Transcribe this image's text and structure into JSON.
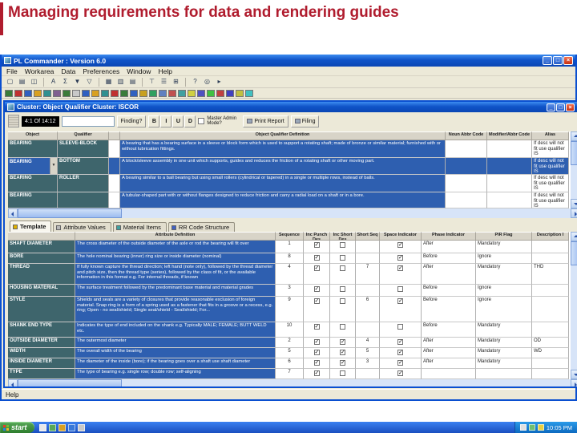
{
  "slide": {
    "title": "Managing requirements for data and rendering guides",
    "accent_color": "#B01C2E"
  },
  "app": {
    "title": "PL Commander : Version 6.0",
    "menus": [
      "File",
      "Workarea",
      "Data",
      "Preferences",
      "Window",
      "Help"
    ],
    "status": "Help"
  },
  "icons": {
    "dropdown": "▼"
  },
  "window_controls": [
    {
      "name": "minimize",
      "glyph": "_"
    },
    {
      "name": "maximize",
      "glyph": "□"
    },
    {
      "name": "close",
      "glyph": "×"
    }
  ],
  "toolbars": {
    "row1": [
      {
        "name": "new-icon",
        "glyph": "▢"
      },
      {
        "name": "open-icon",
        "glyph": "▤"
      },
      {
        "name": "save-icon",
        "glyph": "◫"
      },
      {
        "sep": true
      },
      {
        "name": "font-icon",
        "glyph": "A"
      },
      {
        "name": "sum-icon",
        "glyph": "Σ"
      },
      {
        "name": "sort-descending-icon",
        "glyph": "▼"
      },
      {
        "name": "filter-icon",
        "glyph": "▽"
      },
      {
        "sep": true
      },
      {
        "name": "grid-icon",
        "glyph": "▦"
      },
      {
        "name": "form-icon",
        "glyph": "▥"
      },
      {
        "name": "columns-icon",
        "glyph": "▤"
      },
      {
        "sep": true
      },
      {
        "name": "tree-icon",
        "glyph": "⊤"
      },
      {
        "name": "list-icon",
        "glyph": "☰"
      },
      {
        "name": "hierarchy-icon",
        "glyph": "⊞"
      },
      {
        "sep": true
      },
      {
        "name": "help-icon",
        "glyph": "?"
      },
      {
        "name": "search-icon",
        "glyph": "◎"
      },
      {
        "name": "go-icon",
        "glyph": "▸"
      }
    ],
    "row2_colors": [
      "#3a7c3a",
      "#c03030",
      "#3060c0",
      "#d8a020",
      "#309090",
      "#806090",
      "#3a7c3a",
      "#c8c8c8",
      "#3060c0",
      "#d8a020",
      "#309090",
      "#c03030",
      "#3a7c3a",
      "#3060c0",
      "#c8a020",
      "#30a060",
      "#6080c0",
      "#c05050",
      "#40a0a0",
      "#d0d040",
      "#5050c0",
      "#40c040",
      "#c04040",
      "#4040c0",
      "#c0c040",
      "#40c0c0"
    ]
  },
  "cluster": {
    "title": "Cluster: Object Qualifier Cluster: ISCOR",
    "toolbar": {
      "record_counter": "4:1 Of 14:12",
      "search_value": "",
      "find_button": "Finding?",
      "format_buttons": [
        "B",
        "I",
        "U",
        "D"
      ],
      "master_label": "Master Admin Mode?",
      "print_button": "Print Report",
      "filing_button": "Filing"
    },
    "grid": {
      "columns": [
        "Object",
        "Qualifier",
        "",
        "Object Qualifier Definition",
        "Noun Abbr Code",
        "Modifier/Abbr Code",
        "Alias"
      ],
      "rows": [
        {
          "object": "BEARING",
          "qualifier": "SLEEVE-BLOCK",
          "definition": "A bearing that has a bearing surface in a sleeve or block form which is used to support a rotating shaft; made of bronze or similar material; furnished with or without lubrication fittings.",
          "noun_abbr": "",
          "modifier_abbr": "",
          "alias": "If desc will not fit use qualifier IS",
          "selected": false,
          "combo": false
        },
        {
          "object": "BEARING",
          "qualifier": "BOTTOM",
          "definition": "A block/sleeve assembly in one unit which supports, guides and reduces the friction of a rotating shaft or other moving part.",
          "noun_abbr": "",
          "modifier_abbr": "",
          "alias": "If desc will not fit use qualifier IS",
          "selected": true,
          "combo": true
        },
        {
          "object": "BEARING",
          "qualifier": "ROLLER",
          "definition": "A bearing similar to a ball bearing but using small rollers (cylindrical or tapered) in a single or multiple rows, instead of balls.",
          "noun_abbr": "",
          "modifier_abbr": "",
          "alias": "If desc will not fit use qualifier IS",
          "selected": false,
          "combo": false
        },
        {
          "object": "BEARING",
          "qualifier": "",
          "definition": "A tubular-shaped part with or without flanges designed to reduce friction and carry a radial load on a shaft or in a bore.",
          "noun_abbr": "",
          "modifier_abbr": "",
          "alias": "If desc will not fit use qualifier IS",
          "selected": false,
          "combo": false
        }
      ]
    }
  },
  "tabs": [
    {
      "label": "Template",
      "active": true,
      "icon_color": "#E0B000"
    },
    {
      "label": "Attribute Values",
      "active": false,
      "icon_color": "#B8B8B8"
    },
    {
      "label": "Material Items",
      "active": false,
      "icon_color": "#40A0A0"
    },
    {
      "label": "RR Code Structure",
      "active": false,
      "icon_color": "#4060C0"
    }
  ],
  "attributes": {
    "columns": [
      "",
      "Attribute Definition",
      "Sequence",
      "Inc Punch Des",
      "Inc Short Des",
      "Short Seq",
      "Space Indicator",
      "Phase Indicator",
      "PIR Flag",
      "Description I"
    ],
    "rows": [
      {
        "name": "SHAFT DIAMETER",
        "definition": "The cross diameter of the outside diameter of the axle or rod the bearing will fit over",
        "sequence": "1",
        "inc_punch": true,
        "inc_short": false,
        "short_seq": "",
        "space": true,
        "phase": "After",
        "pir": "Mandatory",
        "desc": ""
      },
      {
        "name": "BORE",
        "definition": "The hole nominal bearing (inner) ring size or inside diameter (nominal)",
        "sequence": "8",
        "inc_punch": true,
        "inc_short": false,
        "short_seq": "",
        "space": true,
        "phase": "Before",
        "pir": "Ignore",
        "desc": ""
      },
      {
        "name": "THREAD",
        "definition": "If fully known capture the thread direction; left hand (note only), followed by the thread diameter and pitch size, then the thread type (series), followed by the class of fit, or the available information in this format e.g. For internal threads, if known",
        "sequence": "4",
        "inc_punch": true,
        "inc_short": false,
        "short_seq": "7",
        "space": true,
        "phase": "After",
        "pir": "Mandatory",
        "desc": "THD"
      },
      {
        "name": "HOUSING MATERIAL",
        "definition": "The surface treatment followed by the predominant base material and material grades",
        "sequence": "3",
        "inc_punch": true,
        "inc_short": false,
        "short_seq": "",
        "space": false,
        "phase": "Before",
        "pir": "Ignore",
        "desc": ""
      },
      {
        "name": "STYLE",
        "definition": "Shields and seals are a variety of closures that provide reasonable exclusion of foreign material. Snap ring is a form of a spring used as a fastener that fits in a groove or a recess, e.g. ring; Open - no seal/shield; Single seal/shield - Seal/shield; For...",
        "sequence": "9",
        "inc_punch": true,
        "inc_short": false,
        "short_seq": "6",
        "space": true,
        "phase": "Before",
        "pir": "Ignore",
        "desc": ""
      },
      {
        "name": "SHANK END TYPE",
        "definition": "Indicates the type of end included on the shank e.g. Typically MALE; FEMALE; BUTT WELD etc.",
        "sequence": "10",
        "inc_punch": true,
        "inc_short": false,
        "short_seq": "",
        "space": false,
        "phase": "Before",
        "pir": "Mandatory",
        "desc": ""
      },
      {
        "name": "OUTSIDE DIAMETER",
        "definition": "The outermost diameter",
        "sequence": "2",
        "inc_punch": true,
        "inc_short": true,
        "short_seq": "4",
        "space": true,
        "phase": "After",
        "pir": "Mandatory",
        "desc": "OD"
      },
      {
        "name": "WIDTH",
        "definition": "The overall width of the bearing",
        "sequence": "5",
        "inc_punch": true,
        "inc_short": true,
        "short_seq": "5",
        "space": true,
        "phase": "After",
        "pir": "Mandatory",
        "desc": "WD"
      },
      {
        "name": "INSIDE DIAMETER",
        "definition": "The diameter of the inside (bore); if the bearing goes over a shaft use shaft diameter",
        "sequence": "6",
        "inc_punch": true,
        "inc_short": true,
        "short_seq": "3",
        "space": true,
        "phase": "After",
        "pir": "Mandatory",
        "desc": ""
      },
      {
        "name": "TYPE",
        "definition": "The type of bearing e.g. single row; double row; self-aligning",
        "sequence": "7",
        "inc_punch": true,
        "inc_short": false,
        "short_seq": "",
        "space": true,
        "phase": "",
        "pir": "",
        "desc": ""
      }
    ]
  },
  "taskbar": {
    "start": "start",
    "clock": "10:05 PM",
    "quick_launch_colors": [
      "#e8e8e8",
      "#58a858",
      "#d8a020",
      "#3878d8",
      "#c8c8c8"
    ],
    "tray_colors": [
      "#e0e0e0",
      "#70c070",
      "#e8d040"
    ]
  }
}
